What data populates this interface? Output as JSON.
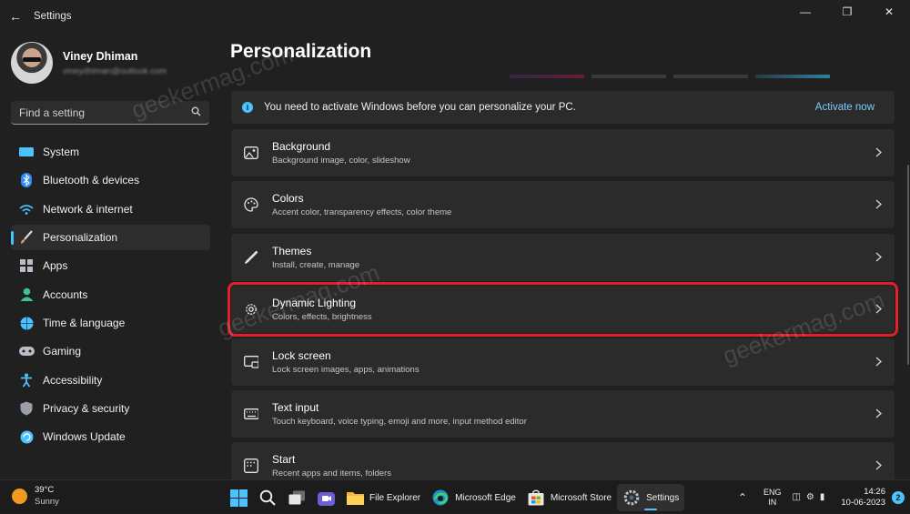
{
  "window": {
    "title": "Settings",
    "back_icon": "back-arrow-icon",
    "controls": [
      "minimize-icon",
      "maximize-icon",
      "close-icon"
    ]
  },
  "profile": {
    "name": "Viney Dhiman",
    "email": "vineydhiman@outlook.com"
  },
  "search": {
    "placeholder": "Find a setting",
    "icon": "search-icon"
  },
  "nav": [
    {
      "label": "System",
      "icon": "system-icon",
      "color": "#4cc2ff",
      "active": false
    },
    {
      "label": "Bluetooth & devices",
      "icon": "bluetooth-icon",
      "color": "#2f8cf7",
      "active": false
    },
    {
      "label": "Network & internet",
      "icon": "wifi-icon",
      "color": "#4cc2ff",
      "active": false
    },
    {
      "label": "Personalization",
      "icon": "brush-icon",
      "color": "#e89a4a",
      "active": true
    },
    {
      "label": "Apps",
      "icon": "apps-icon",
      "color": "#b9bdc7",
      "active": false
    },
    {
      "label": "Accounts",
      "icon": "accounts-icon",
      "color": "#3ec28f",
      "active": false
    },
    {
      "label": "Time & language",
      "icon": "globe-icon",
      "color": "#4cc2ff",
      "active": false
    },
    {
      "label": "Gaming",
      "icon": "gaming-icon",
      "color": "#b9bdc7",
      "active": false
    },
    {
      "label": "Accessibility",
      "icon": "accessibility-icon",
      "color": "#4cc2ff",
      "active": false
    },
    {
      "label": "Privacy & security",
      "icon": "shield-icon",
      "color": "#9aa0a8",
      "active": false
    },
    {
      "label": "Windows Update",
      "icon": "update-icon",
      "color": "#4cc2ff",
      "active": false
    }
  ],
  "main": {
    "title": "Personalization",
    "notice": {
      "text": "You need to activate Windows before you can personalize your PC.",
      "action": "Activate now",
      "icon": "info-icon"
    },
    "cards": [
      {
        "title": "Background",
        "subtitle": "Background image, color, slideshow",
        "icon": "picture-icon"
      },
      {
        "title": "Colors",
        "subtitle": "Accent color, transparency effects, color theme",
        "icon": "palette-icon"
      },
      {
        "title": "Themes",
        "subtitle": "Install, create, manage",
        "icon": "pen-icon"
      },
      {
        "title": "Dynamic Lighting",
        "subtitle": "Colors, effects, brightness",
        "icon": "gear-icon",
        "highlight": true
      },
      {
        "title": "Lock screen",
        "subtitle": "Lock screen images, apps, animations",
        "icon": "lock-screen-icon"
      },
      {
        "title": "Text input",
        "subtitle": "Touch keyboard, voice typing, emoji and more, input method editor",
        "icon": "keyboard-icon"
      },
      {
        "title": "Start",
        "subtitle": "Recent apps and items, folders",
        "icon": "start-icon"
      }
    ]
  },
  "taskbar": {
    "weather": {
      "temp": "39°C",
      "condition": "Sunny"
    },
    "apps": [
      {
        "label": "",
        "icon": "windows-start-icon"
      },
      {
        "label": "",
        "icon": "search-icon"
      },
      {
        "label": "",
        "icon": "task-view-icon"
      },
      {
        "label": "",
        "icon": "meet-icon"
      },
      {
        "label": "File Explorer",
        "icon": "folder-icon"
      },
      {
        "label": "Microsoft Edge",
        "icon": "edge-icon"
      },
      {
        "label": "Microsoft Store",
        "icon": "store-icon"
      },
      {
        "label": "Settings",
        "icon": "settings-gear-icon",
        "active": true
      }
    ],
    "tray": {
      "lang_top": "ENG",
      "lang_bottom": "IN",
      "time": "14:26",
      "date": "10-06-2023",
      "notifications": "2"
    }
  },
  "watermark": "geekermag.com"
}
